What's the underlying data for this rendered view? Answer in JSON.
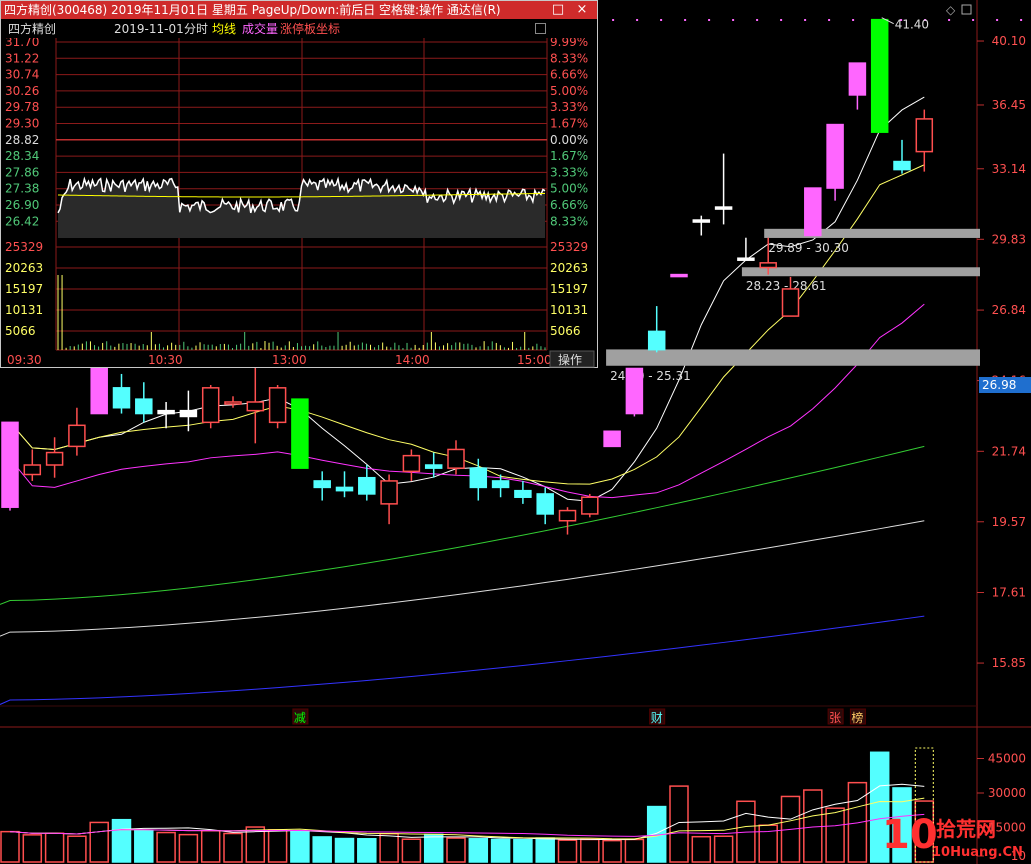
{
  "popup": {
    "title": "四方精创(300468) 2019年11月01日 星期五 PageUp/Down:前后日 空格键:操作 通达信(R)",
    "close_label": "×",
    "minimize_label": "□",
    "info": {
      "name": "四方精创",
      "date": "2019-11-01",
      "mode": "分时",
      "avg_label": "均线",
      "vol_label": "成交量",
      "limit_label": "涨停板坐标"
    },
    "price_ticks": [
      "31.70",
      "31.22",
      "30.74",
      "30.26",
      "29.78",
      "29.30",
      "28.82",
      "28.34",
      "27.86",
      "27.38",
      "26.90",
      "26.42"
    ],
    "pct_ticks": [
      "9.99%",
      "8.33%",
      "6.66%",
      "5.00%",
      "3.33%",
      "1.67%",
      "0.00%",
      "1.67%",
      "3.33%",
      "5.00%",
      "6.66%",
      "8.33%"
    ],
    "vol_ticks": [
      "25329",
      "20263",
      "15197",
      "10131",
      "5066"
    ],
    "time_ticks": [
      "09:30",
      "10:30",
      "13:00",
      "14:00",
      "15:00"
    ],
    "action_button": "操作",
    "colors": {
      "title_bg": "#cf2b2b",
      "up": "#ff5050",
      "down": "#50c878",
      "grid": "#8b1a1a"
    }
  },
  "chart": {
    "price_axis": [
      "40.10",
      "36.45",
      "33.14",
      "29.83",
      "26.84",
      "24.16",
      "21.74",
      "19.57",
      "17.61",
      "15.85"
    ],
    "vol_axis": [
      "45000",
      "30000",
      "15000",
      "10"
    ],
    "current_price_tag": "26.98",
    "high_label": "41.40",
    "zones": [
      {
        "label": "29.89 - 30.30"
      },
      {
        "label": "28.23 - 28.61"
      },
      {
        "label": "24.70 - 25.31"
      }
    ],
    "markers": [
      "减",
      "财",
      "张",
      "榜"
    ],
    "colors": {
      "up": "#ff4f4f",
      "down": "#54ffff",
      "limit_up": "#ff66ff",
      "limit_big": "#00ff00",
      "ma5": "#ffffff",
      "ma10": "#ffff66",
      "ma20": "#ff33ff",
      "ma60": "#33cc33",
      "ma120": "#dddddd",
      "ma250": "#3333ff"
    }
  },
  "watermark": {
    "text_a": "拾荒网",
    "text_b": "10Huang.CN"
  },
  "chart_data": {
    "type": "candlestick",
    "ylim": [
      15.0,
      42.0
    ],
    "candles": [
      {
        "o": 20.0,
        "h": 20.6,
        "l": 19.9,
        "c": 22.7,
        "kind": "limit"
      },
      {
        "o": 21.3,
        "h": 21.8,
        "l": 20.8,
        "c": 21.0,
        "kind": "up"
      },
      {
        "o": 21.3,
        "h": 22.2,
        "l": 20.9,
        "c": 21.7,
        "kind": "up"
      },
      {
        "o": 21.9,
        "h": 23.2,
        "l": 21.6,
        "c": 22.6,
        "kind": "up"
      },
      {
        "o": 24.7,
        "h": 24.7,
        "l": 23.0,
        "c": 23.0,
        "kind": "limit"
      },
      {
        "o": 23.9,
        "h": 24.4,
        "l": 23.0,
        "c": 23.2,
        "kind": "down"
      },
      {
        "o": 23.5,
        "h": 24.1,
        "l": 22.7,
        "c": 23.0,
        "kind": "down"
      },
      {
        "o": 23.0,
        "h": 23.4,
        "l": 22.5,
        "c": 23.1,
        "kind": "flat"
      },
      {
        "o": 22.9,
        "h": 23.8,
        "l": 22.4,
        "c": 23.1,
        "kind": "flat"
      },
      {
        "o": 22.7,
        "h": 24.0,
        "l": 22.5,
        "c": 23.9,
        "kind": "up"
      },
      {
        "o": 23.4,
        "h": 23.6,
        "l": 23.2,
        "c": 23.4,
        "kind": "up"
      },
      {
        "o": 23.1,
        "h": 25.3,
        "l": 22.0,
        "c": 23.4,
        "kind": "up"
      },
      {
        "o": 22.7,
        "h": 24.0,
        "l": 22.5,
        "c": 23.9,
        "kind": "up"
      },
      {
        "o": 23.5,
        "h": 23.5,
        "l": 21.2,
        "c": 21.2,
        "kind": "bigdown"
      },
      {
        "o": 20.8,
        "h": 21.1,
        "l": 20.2,
        "c": 20.6,
        "kind": "down"
      },
      {
        "o": 20.6,
        "h": 21.1,
        "l": 20.3,
        "c": 20.5,
        "kind": "down"
      },
      {
        "o": 20.9,
        "h": 21.3,
        "l": 20.2,
        "c": 20.4,
        "kind": "down"
      },
      {
        "o": 20.1,
        "h": 21.0,
        "l": 19.5,
        "c": 20.8,
        "kind": "up"
      },
      {
        "o": 21.1,
        "h": 21.8,
        "l": 20.8,
        "c": 21.6,
        "kind": "up"
      },
      {
        "o": 21.2,
        "h": 21.7,
        "l": 20.9,
        "c": 21.3,
        "kind": "down"
      },
      {
        "o": 21.2,
        "h": 22.1,
        "l": 21.0,
        "c": 21.8,
        "kind": "up"
      },
      {
        "o": 21.2,
        "h": 21.5,
        "l": 20.2,
        "c": 20.6,
        "kind": "down"
      },
      {
        "o": 20.8,
        "h": 21.0,
        "l": 20.3,
        "c": 20.6,
        "kind": "down"
      },
      {
        "o": 20.5,
        "h": 20.8,
        "l": 20.1,
        "c": 20.3,
        "kind": "down"
      },
      {
        "o": 20.4,
        "h": 20.6,
        "l": 19.5,
        "c": 19.8,
        "kind": "down"
      },
      {
        "o": 19.6,
        "h": 20.0,
        "l": 19.2,
        "c": 19.9,
        "kind": "up"
      },
      {
        "o": 19.8,
        "h": 20.4,
        "l": 19.7,
        "c": 20.3,
        "kind": "up"
      },
      {
        "o": 21.9,
        "h": 22.4,
        "l": 21.9,
        "c": 22.4,
        "kind": "limit"
      },
      {
        "o": 23.0,
        "h": 24.6,
        "l": 22.9,
        "c": 24.6,
        "kind": "limit"
      },
      {
        "o": 26.0,
        "h": 27.0,
        "l": 25.2,
        "c": 25.3,
        "kind": "down"
      },
      {
        "o": 28.3,
        "h": 28.3,
        "l": 28.3,
        "c": 28.3,
        "kind": "limit"
      },
      {
        "o": 30.7,
        "h": 30.9,
        "l": 30.0,
        "c": 30.7,
        "kind": "flat"
      },
      {
        "o": 31.3,
        "h": 33.9,
        "l": 30.5,
        "c": 31.3,
        "kind": "flat"
      },
      {
        "o": 29.0,
        "h": 29.9,
        "l": 29.0,
        "c": 29.0,
        "kind": "flat"
      },
      {
        "o": 28.6,
        "h": 29.9,
        "l": 28.3,
        "c": 28.8,
        "kind": "up"
      },
      {
        "o": 26.6,
        "h": 28.2,
        "l": 26.6,
        "c": 27.7,
        "kind": "up"
      },
      {
        "o": 30.0,
        "h": 32.1,
        "l": 30.0,
        "c": 32.2,
        "kind": "limit"
      },
      {
        "o": 32.2,
        "h": 35.4,
        "l": 31.6,
        "c": 35.4,
        "kind": "limit"
      },
      {
        "o": 37.0,
        "h": 38.8,
        "l": 36.2,
        "c": 38.8,
        "kind": "limit"
      },
      {
        "o": 35.0,
        "h": 41.4,
        "l": 35.0,
        "c": 41.4,
        "kind": "limit_big"
      },
      {
        "o": 33.5,
        "h": 34.6,
        "l": 32.9,
        "c": 33.1,
        "kind": "down"
      },
      {
        "o": 34.0,
        "h": 36.2,
        "l": 33.0,
        "c": 35.7,
        "kind": "up"
      }
    ],
    "volumes": [
      13200,
      11800,
      12500,
      11200,
      17200,
      18400,
      13800,
      12800,
      11900,
      13600,
      12400,
      15200,
      14000,
      13400,
      10900,
      10200,
      10100,
      12300,
      9900,
      12000,
      10400,
      10100,
      9800,
      9700,
      10400,
      9500,
      9800,
      9300,
      9800,
      24100,
      33000,
      11000,
      11200,
      26400,
      16000,
      28500,
      31300,
      23400,
      34500,
      47700,
      32200,
      26500
    ]
  }
}
